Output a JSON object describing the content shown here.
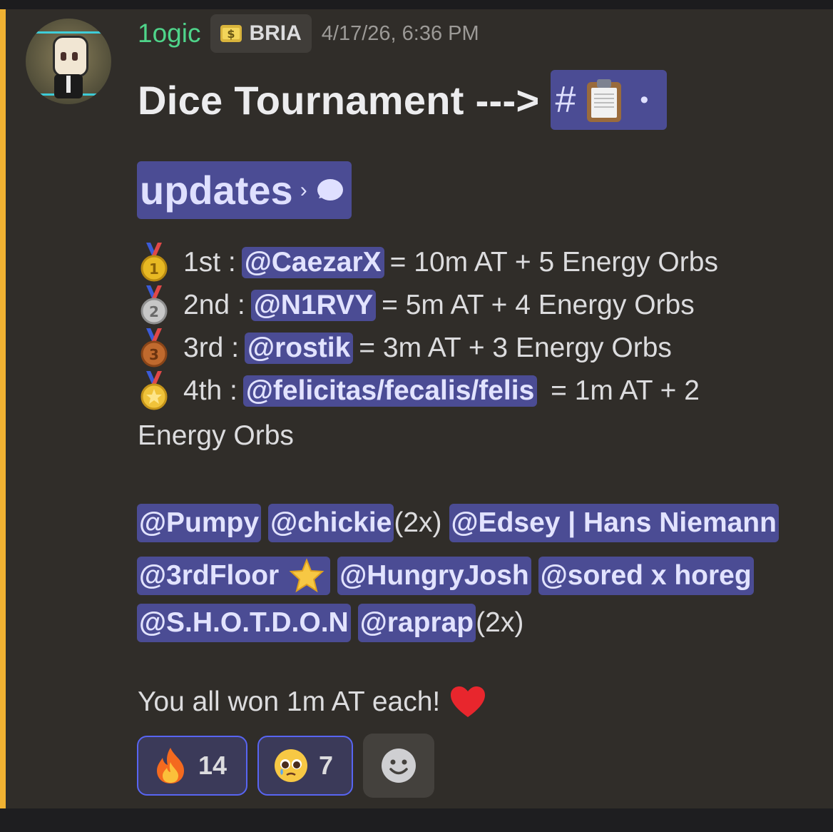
{
  "message": {
    "author": {
      "username": "1ogic",
      "role_tag": "BRIA",
      "avatar_icon": "pixel-character-avatar"
    },
    "timestamp": "4/17/26, 6:36 PM",
    "title": "Dice Tournament --->",
    "channel_link": {
      "prefix": "#",
      "emoji": "clipboard-icon",
      "separator": "•",
      "name": "updates",
      "chevron": "›",
      "thread_icon": "chat-bubble-icon"
    },
    "placements": [
      {
        "medal": "gold-medal-icon",
        "place": "1st :",
        "winner": "@CaezarX",
        "prize": "= 10m AT + 5 Energy Orbs"
      },
      {
        "medal": "silver-medal-icon",
        "place": "2nd :",
        "winner": "@N1RVY",
        "prize": "= 5m AT + 4 Energy Orbs"
      },
      {
        "medal": "bronze-medal-icon",
        "place": "3rd :",
        "winner": "@rostik",
        "prize": "= 3m AT + 3 Energy Orbs"
      },
      {
        "medal": "sports-medal-icon",
        "place": "4th :",
        "winner": "@felicitas/fecalis/felis",
        "prize": " = 1m AT + 2"
      }
    ],
    "placement_wrap": "Energy Orbs",
    "mentions": {
      "row1": {
        "m1": "@Pumpy",
        "m2": "@chickie",
        "m2_suffix": "(2x)",
        "m3": "@Edsey | Hans Niemann"
      },
      "row2": {
        "m1": "@3rdFloor",
        "m2": "@HungryJosh",
        "m3": "@sored x horeg"
      },
      "row3": {
        "m1": "@S.H.O.T.D.O.N",
        "m2": "@raprap",
        "m2_suffix": "(2x)"
      }
    },
    "closing": "You all won 1m AT each!",
    "reactions": [
      {
        "emoji": "fire-icon",
        "count": "14"
      },
      {
        "emoji": "pleading-face-icon",
        "count": "7"
      }
    ]
  },
  "colors": {
    "accent_bar": "#f0b232",
    "username": "#4fd48a",
    "mention_bg": "#4b4c94",
    "reaction_border": "#5865f2"
  }
}
